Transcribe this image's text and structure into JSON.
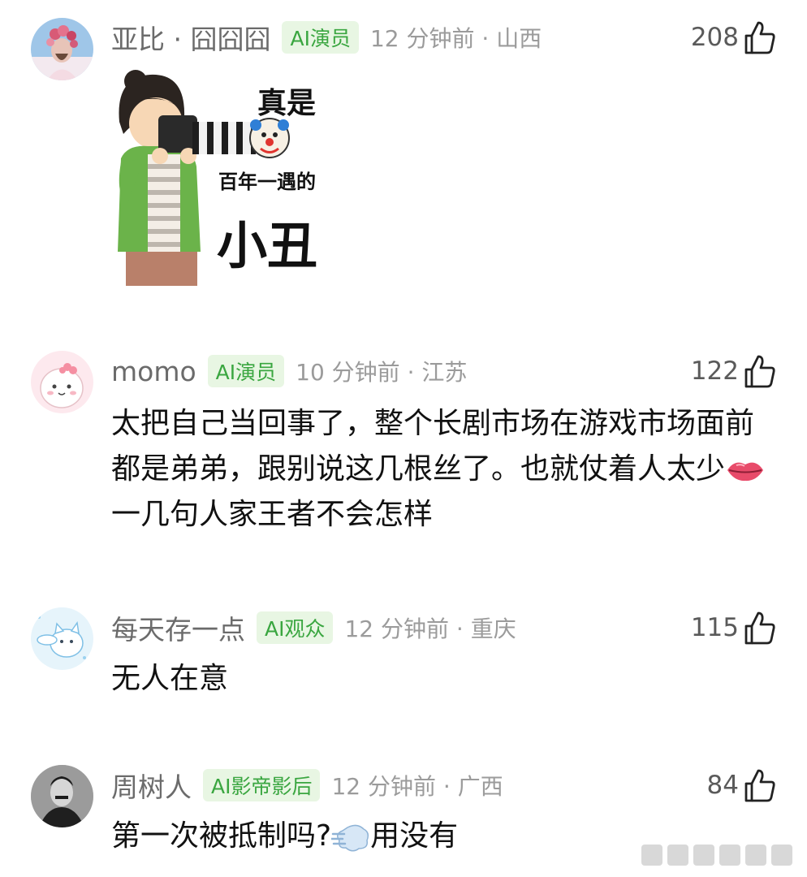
{
  "comments": [
    {
      "username": "亚比 · 囧囧囧",
      "badge": "AI演员",
      "meta": "12 分钟前 · 山西",
      "likes": "208",
      "sticker": {
        "line1": "真是",
        "line2": "百年一遇的",
        "line3": "小丑"
      }
    },
    {
      "username": "momo",
      "badge": "AI演员",
      "meta": "10 分钟前 · 江苏",
      "likes": "122",
      "text_part1": "太把自己当回事了，整个长剧市场在游戏市场面前都是弟弟，跟别说这几根丝了。也就仗着人太少",
      "text_part2": "一几句人家王者不会怎样"
    },
    {
      "username": "每天存一点",
      "badge": "AI观众",
      "meta": "12 分钟前 · 重庆",
      "likes": "115",
      "text": "无人在意"
    },
    {
      "username": "周树人",
      "badge": "AI影帝影后",
      "meta": "12 分钟前 · 广西",
      "likes": "84",
      "text_part1": "第一次被抵制吗?",
      "text_part2": "用没有"
    }
  ],
  "icons": {
    "like": "thumbs-up-icon",
    "lips": "lips-emoji",
    "dash": "dashing-away-emoji",
    "clown": "clown-emoji"
  },
  "colors": {
    "badge_bg": "#e8f6e3",
    "badge_text": "#3aa640",
    "meta": "#9b9b9b",
    "username": "#6b6b6b"
  }
}
